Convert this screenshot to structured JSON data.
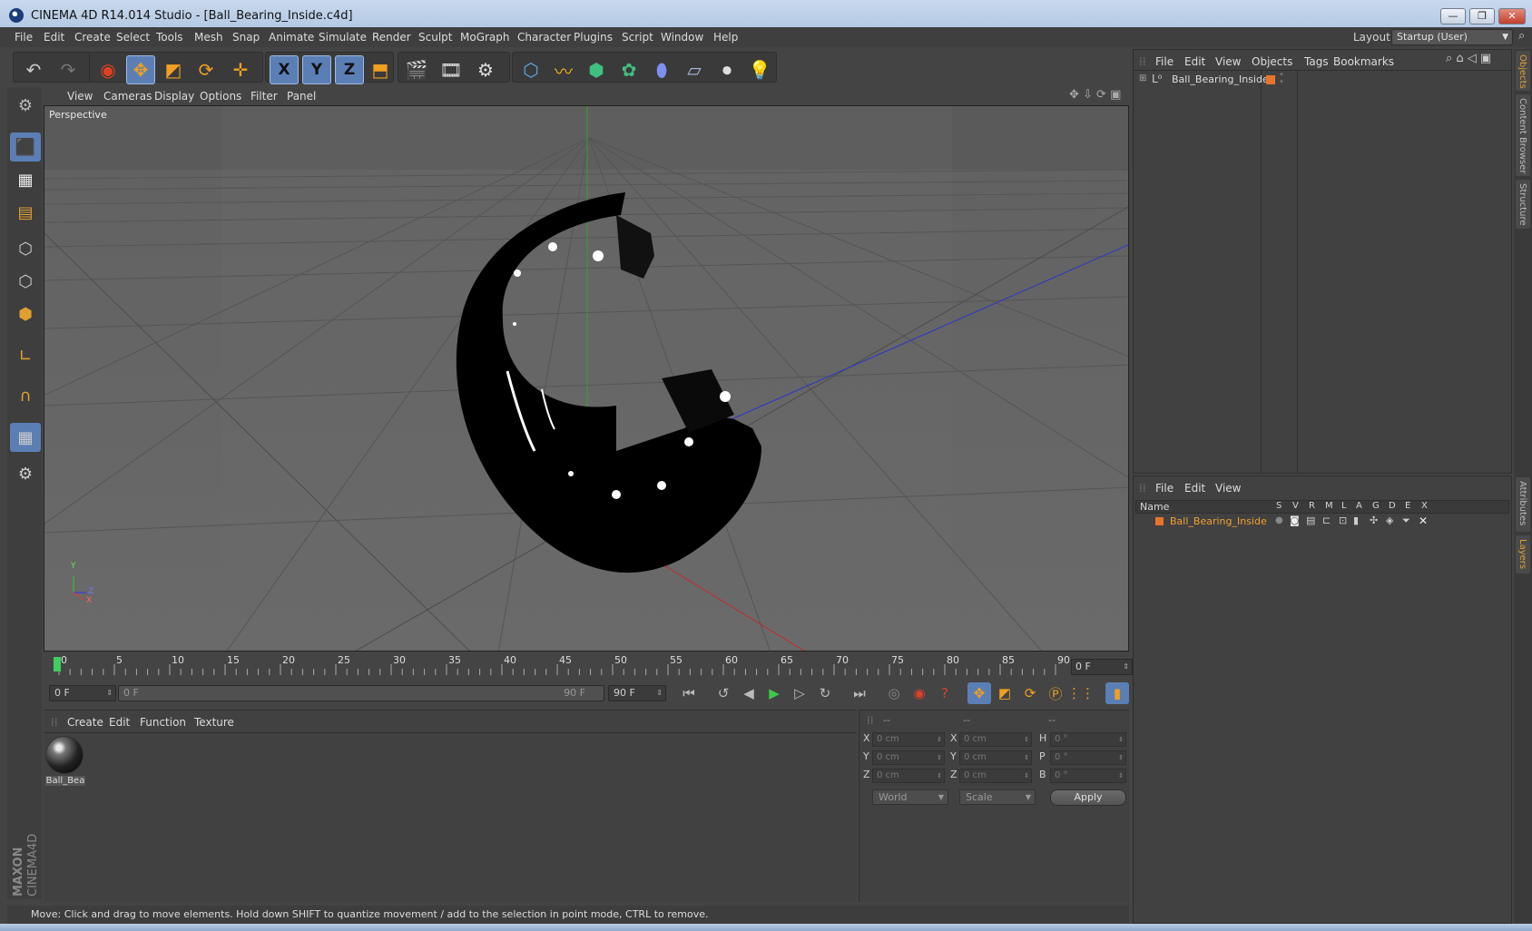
{
  "window": {
    "title": "CINEMA 4D R14.014 Studio - [Ball_Bearing_Inside.c4d]",
    "min_label": "—",
    "max_label": "❐",
    "close_label": "✕"
  },
  "menubar": {
    "items": [
      "File",
      "Edit",
      "Create",
      "Select",
      "Tools",
      "Mesh",
      "Snap",
      "Animate",
      "Simulate",
      "Render",
      "Sculpt",
      "MoGraph",
      "Character",
      "Plugins",
      "Script",
      "Window",
      "Help"
    ],
    "layout_label": "Layout:",
    "layout_value": "Startup (User)"
  },
  "toolbar": {
    "axis_x": "X",
    "axis_y": "Y",
    "axis_z": "Z"
  },
  "viewport": {
    "menu": [
      "View",
      "Cameras",
      "Display",
      "Options",
      "Filter",
      "Panel"
    ],
    "camera_label": "Perspective",
    "axis_y": "Y",
    "axis_z": "Z",
    "axis_x": "X"
  },
  "timeline": {
    "ticks": [
      "0",
      "5",
      "10",
      "15",
      "20",
      "25",
      "30",
      "35",
      "40",
      "45",
      "50",
      "55",
      "60",
      "65",
      "70",
      "75",
      "80",
      "85",
      "90"
    ],
    "current_frame": "0 F",
    "start_field": "0 F",
    "range_start": "0 F",
    "range_end": "90 F",
    "end_field": "90 F"
  },
  "materials": {
    "menu": [
      "Create",
      "Edit",
      "Function",
      "Texture"
    ],
    "items": [
      {
        "name": "Ball_Bea"
      }
    ]
  },
  "coordinates": {
    "headers": [
      "--",
      "--",
      "--"
    ],
    "pos_labels": [
      "X",
      "Y",
      "Z"
    ],
    "size_labels": [
      "X",
      "Y",
      "Z"
    ],
    "rot_labels": [
      "H",
      "P",
      "B"
    ],
    "pos_values": [
      "0 cm",
      "0 cm",
      "0 cm"
    ],
    "size_values": [
      "0 cm",
      "0 cm",
      "0 cm"
    ],
    "rot_values": [
      "0 °",
      "0 °",
      "0 °"
    ],
    "space_value": "World",
    "mode_value": "Scale",
    "apply_label": "Apply"
  },
  "status": {
    "text": "Move: Click and drag to move elements. Hold down SHIFT to quantize movement / add to the selection in point mode, CTRL to remove."
  },
  "object_manager": {
    "menu": [
      "File",
      "Edit",
      "View",
      "Objects",
      "Tags",
      "Bookmarks"
    ],
    "objects": [
      {
        "name": "Ball_Bearing_Inside",
        "layer_color": "#e8742a"
      }
    ]
  },
  "layer_manager": {
    "menu": [
      "File",
      "Edit",
      "View"
    ],
    "columns": [
      "Name",
      "S",
      "V",
      "R",
      "M",
      "L",
      "A",
      "G",
      "D",
      "E",
      "X"
    ],
    "layers": [
      {
        "name": "Ball_Bearing_Inside",
        "color": "#e8742a"
      }
    ]
  },
  "right_tabs": [
    "Objects",
    "Content Browser",
    "Structure",
    "Attributes",
    "Layers"
  ],
  "colors": {
    "accent_blue": "#5b7fb5",
    "icon_orange": "#e0a030",
    "layer_orange": "#e8742a"
  }
}
